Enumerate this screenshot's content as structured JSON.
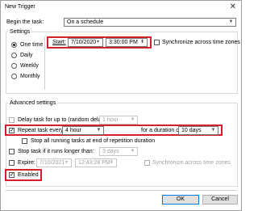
{
  "window": {
    "title": "New Trigger",
    "close_glyph": "✕"
  },
  "begin": {
    "label": "Begin the task:",
    "value": "On a schedule"
  },
  "settings": {
    "group_label": "Settings",
    "options": [
      "One time",
      "Daily",
      "Weekly",
      "Monthly"
    ],
    "selected": "One time",
    "start_label": "Start:",
    "start_date": "7/10/2020",
    "start_time": "3:30:00 PM",
    "sync_label": "Synchronize across time zones"
  },
  "advanced": {
    "group_label": "Advanced settings",
    "delay_label": "Delay task for up to (random delay):",
    "delay_value": "1 hour",
    "repeat_label": "Repeat task every:",
    "repeat_value": "4 hour",
    "duration_label": "for a duration of:",
    "duration_value": "10 days",
    "stop_running_label": "Stop all running tasks at end of repetition duration",
    "stop_longer_label": "Stop task if it runs longer than:",
    "stop_longer_value": "3 days",
    "expire_label": "Expire:",
    "expire_date": "7/10/2021",
    "expire_time": "12:43:28 PM",
    "expire_sync_label": "Synchronize across time zones",
    "enabled_label": "Enabled"
  },
  "buttons": {
    "ok": "OK",
    "cancel": "Cancel"
  },
  "colors": {
    "highlight": "#d61f2c",
    "default_button_border": "#0078d7"
  },
  "icons": {
    "dropdown": "chevron-down-icon",
    "calendar": "calendar-icon",
    "spinner": "spinner-icon"
  }
}
